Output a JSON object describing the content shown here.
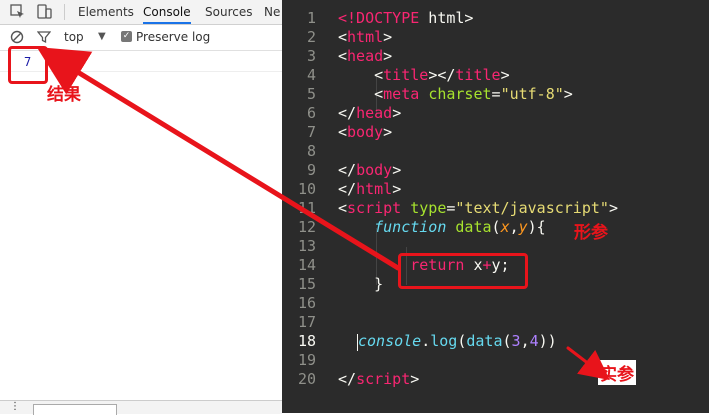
{
  "devtools": {
    "tabs": [
      "Elements",
      "Console",
      "Sources",
      "Ne"
    ],
    "active_tab": "Console",
    "context": "top",
    "preserve_log_label": "Preserve log",
    "console_output": "7"
  },
  "editor": {
    "line_numbers": [
      "1",
      "2",
      "3",
      "4",
      "5",
      "6",
      "7",
      "8",
      "9",
      "10",
      "11",
      "12",
      "13",
      "14",
      "15",
      "16",
      "17",
      "18",
      "19",
      "20"
    ]
  },
  "annotations": {
    "result": "结果",
    "formal_params": "形参",
    "actual_params": "实参"
  },
  "colors": {
    "annotation_red": "#e8141b",
    "editor_bg": "#2b2b2b",
    "tag": "#f92672",
    "attr": "#a6e22e",
    "string": "#e6db74",
    "keyword": "#66d9ef",
    "param": "#fd971f",
    "number": "#ae81ff"
  }
}
